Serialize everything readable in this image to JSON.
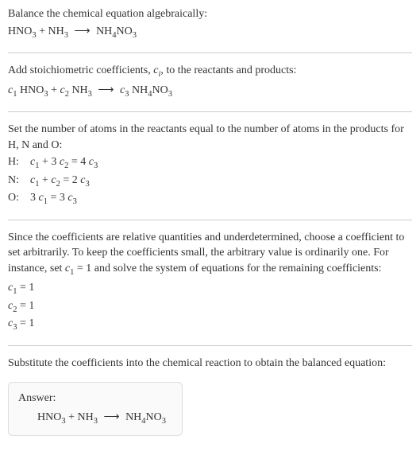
{
  "section1": {
    "text": "Balance the chemical equation algebraically:",
    "eq_lhs1": "HNO",
    "eq_lhs1_sub": "3",
    "eq_plus": " + ",
    "eq_lhs2": "NH",
    "eq_lhs2_sub": "3",
    "eq_arrow": "⟶",
    "eq_rhs": "NH",
    "eq_rhs_sub1": "4",
    "eq_rhs2": "NO",
    "eq_rhs_sub2": "3"
  },
  "section2": {
    "text_a": "Add stoichiometric coefficients, ",
    "ci": "c",
    "ci_sub": "i",
    "text_b": ", to the reactants and products:",
    "c1": "c",
    "c1_sub": "1",
    "sp1": " HNO",
    "sp1_sub": "3",
    "plus1": " + ",
    "c2": "c",
    "c2_sub": "2",
    "sp2": " NH",
    "sp2_sub": "3",
    "arrow": "⟶",
    "c3": "c",
    "c3_sub": "3",
    "sp3": " NH",
    "sp3_sub1": "4",
    "sp3b": "NO",
    "sp3_sub2": "3"
  },
  "section3": {
    "text": "Set the number of atoms in the reactants equal to the number of atoms in the products for H, N and O:",
    "rows": [
      {
        "label": "H:",
        "c1": "c",
        "c1s": "1",
        "plus": " + 3 ",
        "c2": "c",
        "c2s": "2",
        "eq": " = 4 ",
        "c3": "c",
        "c3s": "3"
      },
      {
        "label": "N:",
        "c1": "c",
        "c1s": "1",
        "plus": " + ",
        "c2": "c",
        "c2s": "2",
        "eq": " = 2 ",
        "c3": "c",
        "c3s": "3"
      },
      {
        "label": "O:",
        "pre": "3 ",
        "c1": "c",
        "c1s": "1",
        "eq": " = 3 ",
        "c3": "c",
        "c3s": "3"
      }
    ]
  },
  "section4": {
    "text_a": "Since the coefficients are relative quantities and underdetermined, choose a coefficient to set arbitrarily. To keep the coefficients small, the arbitrary value is ordinarily one. For instance, set ",
    "c1": "c",
    "c1_sub": "1",
    "text_b": " = 1 and solve the system of equations for the remaining coefficients:",
    "coeffs": [
      {
        "c": "c",
        "cs": "1",
        "val": " = 1"
      },
      {
        "c": "c",
        "cs": "2",
        "val": " = 1"
      },
      {
        "c": "c",
        "cs": "3",
        "val": " = 1"
      }
    ]
  },
  "section5": {
    "text": "Substitute the coefficients into the chemical reaction to obtain the balanced equation:"
  },
  "answer": {
    "label": "Answer:",
    "lhs1": "HNO",
    "lhs1_sub": "3",
    "plus": " + ",
    "lhs2": "NH",
    "lhs2_sub": "3",
    "arrow": "⟶",
    "rhs1": "NH",
    "rhs1_sub": "4",
    "rhs2": "NO",
    "rhs2_sub": "3"
  }
}
